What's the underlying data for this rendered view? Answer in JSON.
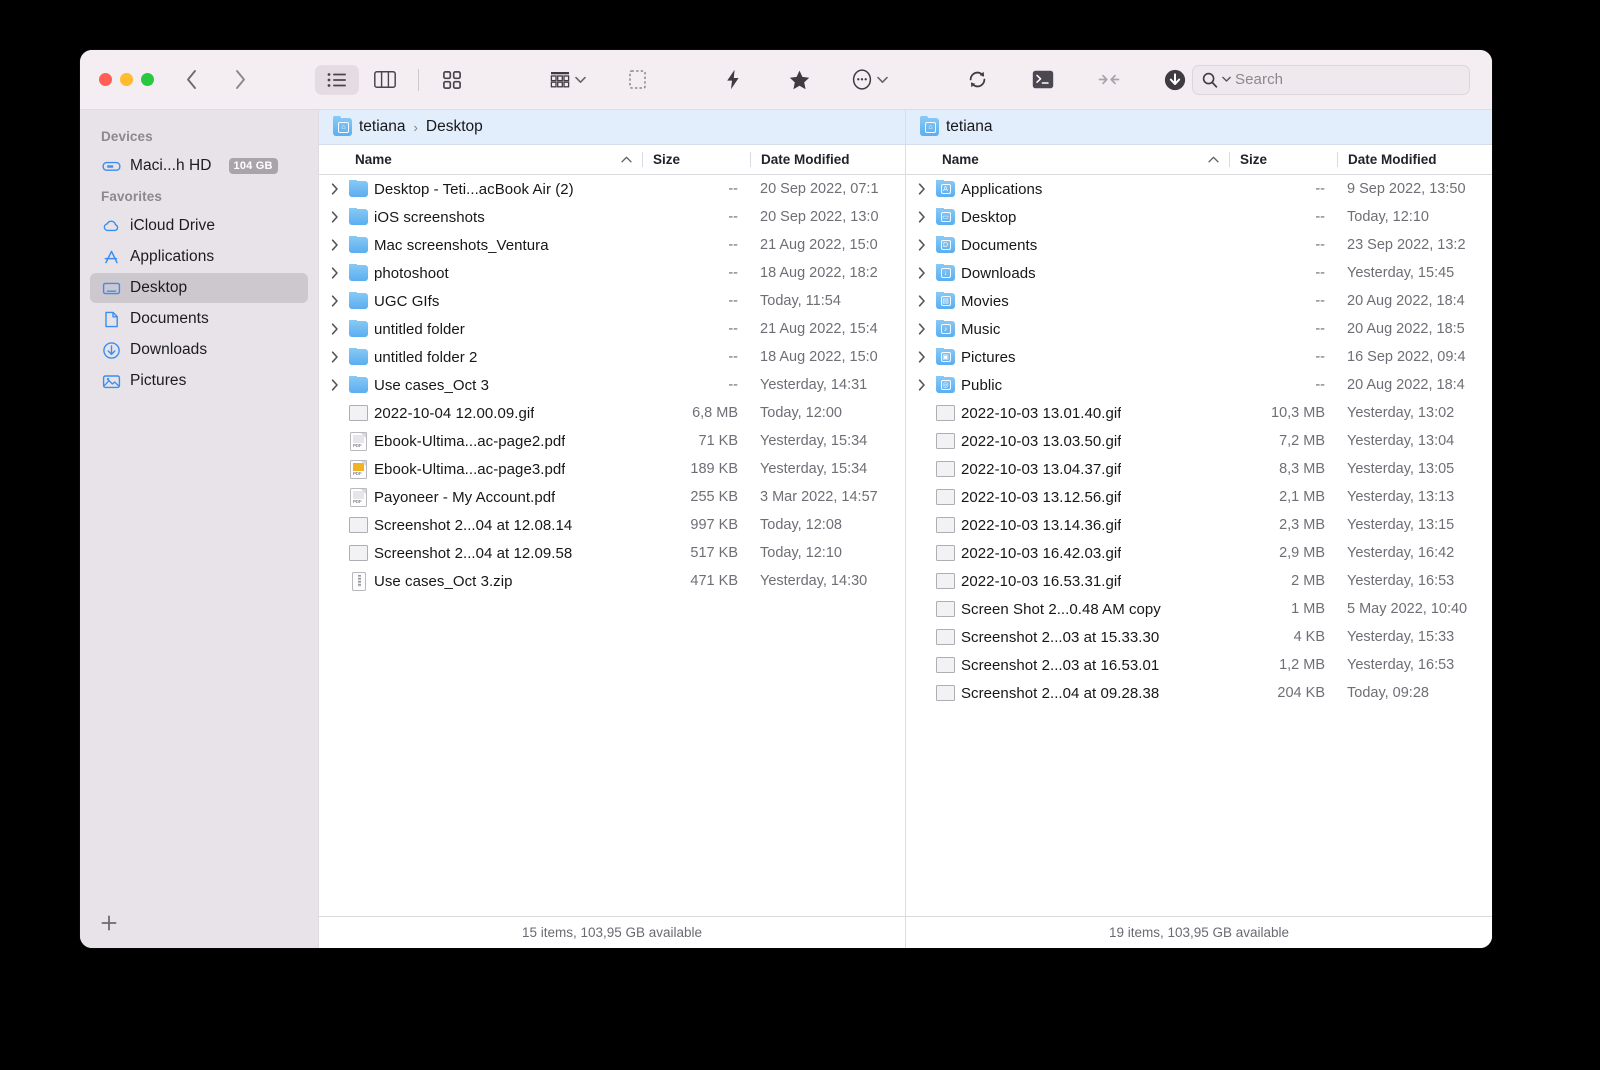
{
  "window": {
    "traffic_lights": [
      "close",
      "minimize",
      "zoom"
    ]
  },
  "toolbar": {
    "back_label": "Back",
    "forward_label": "Forward",
    "view_list_label": "List view",
    "view_column_label": "Column view",
    "view_gallery_label": "Gallery view",
    "group_label": "Group items",
    "selection_label": "Selection",
    "quickaction_label": "Quick actions",
    "favorite_label": "Favorite",
    "more_label": "More",
    "sync_label": "Sync",
    "terminal_label": "Terminal",
    "merge_label": "Merge",
    "download_label": "Download"
  },
  "search": {
    "placeholder": "Search",
    "value": ""
  },
  "sidebar": {
    "sections": [
      {
        "title": "Devices",
        "items": [
          {
            "label": "Maci...h HD",
            "icon": "harddisk-icon",
            "badge": "104 GB",
            "selected": false
          }
        ]
      },
      {
        "title": "Favorites",
        "items": [
          {
            "label": "iCloud Drive",
            "icon": "cloud-icon",
            "badge": "",
            "selected": false
          },
          {
            "label": "Applications",
            "icon": "appstore-icon",
            "badge": "",
            "selected": false
          },
          {
            "label": "Desktop",
            "icon": "desktop-icon",
            "badge": "",
            "selected": true
          },
          {
            "label": "Documents",
            "icon": "document-icon",
            "badge": "",
            "selected": false
          },
          {
            "label": "Downloads",
            "icon": "download-circle-icon",
            "badge": "",
            "selected": false
          },
          {
            "label": "Pictures",
            "icon": "photo-icon",
            "badge": "",
            "selected": false
          }
        ]
      }
    ],
    "add_button_label": "+"
  },
  "panes": [
    {
      "breadcrumb": [
        "tetiana",
        "Desktop"
      ],
      "columns": {
        "name": "Name",
        "size": "Size",
        "date": "Date Modified"
      },
      "sort": "name-ascending",
      "status": "15 items, 103,95 GB available",
      "rows": [
        {
          "name": "Desktop - Teti...acBook Air (2)",
          "size": "--",
          "date": "20 Sep 2022, 07:1",
          "kind": "folder",
          "glyph": "",
          "expandable": true
        },
        {
          "name": "iOS screenshots",
          "size": "--",
          "date": "20 Sep 2022, 13:0",
          "kind": "folder",
          "glyph": "",
          "expandable": true
        },
        {
          "name": "Mac screenshots_Ventura",
          "size": "--",
          "date": "21 Aug 2022, 15:0",
          "kind": "folder",
          "glyph": "",
          "expandable": true
        },
        {
          "name": "photoshoot",
          "size": "--",
          "date": "18 Aug 2022, 18:2",
          "kind": "folder",
          "glyph": "",
          "expandable": true
        },
        {
          "name": "UGC GIfs",
          "size": "--",
          "date": "Today, 11:54",
          "kind": "folder",
          "glyph": "",
          "expandable": true
        },
        {
          "name": "untitled folder",
          "size": "--",
          "date": "21 Aug 2022, 15:4",
          "kind": "folder",
          "glyph": "",
          "expandable": true
        },
        {
          "name": "untitled folder 2",
          "size": "--",
          "date": "18 Aug 2022, 15:0",
          "kind": "folder",
          "glyph": "",
          "expandable": true
        },
        {
          "name": "Use cases_Oct 3",
          "size": "--",
          "date": "Yesterday, 14:31",
          "kind": "folder",
          "glyph": "",
          "expandable": true
        },
        {
          "name": "2022-10-04 12.00.09.gif",
          "size": "6,8 MB",
          "date": "Today, 12:00",
          "kind": "image",
          "thumb": "magenta",
          "expandable": false
        },
        {
          "name": "Ebook-Ultima...ac-page2.pdf",
          "size": "71 KB",
          "date": "Yesterday, 15:34",
          "kind": "pdf",
          "thumb": "plain",
          "expandable": false
        },
        {
          "name": "Ebook-Ultima...ac-page3.pdf",
          "size": "189 KB",
          "date": "Yesterday, 15:34",
          "kind": "pdf",
          "thumb": "yellow",
          "expandable": false
        },
        {
          "name": "Payoneer - My Account.pdf",
          "size": "255 KB",
          "date": "3 Mar 2022, 14:57",
          "kind": "pdf",
          "thumb": "plain",
          "expandable": false
        },
        {
          "name": "Screenshot 2...04 at 12.08.14",
          "size": "997 KB",
          "date": "Today, 12:08",
          "kind": "image",
          "thumb": "grey",
          "expandable": false
        },
        {
          "name": "Screenshot 2...04 at 12.09.58",
          "size": "517 KB",
          "date": "Today, 12:10",
          "kind": "image",
          "thumb": "lightgrey",
          "expandable": false
        },
        {
          "name": "Use cases_Oct 3.zip",
          "size": "471 KB",
          "date": "Yesterday, 14:30",
          "kind": "zip",
          "thumb": "",
          "expandable": false
        }
      ]
    },
    {
      "breadcrumb": [
        "tetiana"
      ],
      "columns": {
        "name": "Name",
        "size": "Size",
        "date": "Date Modified"
      },
      "sort": "name-ascending",
      "status": "19 items, 103,95 GB available",
      "rows": [
        {
          "name": "Applications",
          "size": "--",
          "date": "9 Sep 2022, 13:50",
          "kind": "folder",
          "glyph": "A",
          "expandable": true
        },
        {
          "name": "Desktop",
          "size": "--",
          "date": "Today, 12:10",
          "kind": "folder",
          "glyph": "▭",
          "expandable": true
        },
        {
          "name": "Documents",
          "size": "--",
          "date": "23 Sep 2022, 13:2",
          "kind": "folder",
          "glyph": "D",
          "expandable": true
        },
        {
          "name": "Downloads",
          "size": "--",
          "date": "Yesterday, 15:45",
          "kind": "folder",
          "glyph": "↓",
          "expandable": true
        },
        {
          "name": "Movies",
          "size": "--",
          "date": "20 Aug 2022, 18:4",
          "kind": "folder",
          "glyph": "▤",
          "expandable": true
        },
        {
          "name": "Music",
          "size": "--",
          "date": "20 Aug 2022, 18:5",
          "kind": "folder",
          "glyph": "♪",
          "expandable": true
        },
        {
          "name": "Pictures",
          "size": "--",
          "date": "16 Sep 2022, 09:4",
          "kind": "folder",
          "glyph": "▣",
          "expandable": true
        },
        {
          "name": "Public",
          "size": "--",
          "date": "20 Aug 2022, 18:4",
          "kind": "folder",
          "glyph": "◎",
          "expandable": true
        },
        {
          "name": "2022-10-03 13.01.40.gif",
          "size": "10,3 MB",
          "date": "Yesterday, 13:02",
          "kind": "image",
          "thumb": "purple",
          "expandable": false
        },
        {
          "name": "2022-10-03 13.03.50.gif",
          "size": "7,2 MB",
          "date": "Yesterday, 13:04",
          "kind": "image",
          "thumb": "purple2",
          "expandable": false
        },
        {
          "name": "2022-10-03 13.04.37.gif",
          "size": "8,3 MB",
          "date": "Yesterday, 13:05",
          "kind": "image",
          "thumb": "magenta",
          "expandable": false
        },
        {
          "name": "2022-10-03 13.12.56.gif",
          "size": "2,1 MB",
          "date": "Yesterday, 13:13",
          "kind": "image",
          "thumb": "violet",
          "expandable": false
        },
        {
          "name": "2022-10-03 13.14.36.gif",
          "size": "2,3 MB",
          "date": "Yesterday, 13:15",
          "kind": "image",
          "thumb": "indigo",
          "expandable": false
        },
        {
          "name": "2022-10-03 16.42.03.gif",
          "size": "2,9 MB",
          "date": "Yesterday, 16:42",
          "kind": "image",
          "thumb": "white",
          "expandable": false
        },
        {
          "name": "2022-10-03 16.53.31.gif",
          "size": "2 MB",
          "date": "Yesterday, 16:53",
          "kind": "image",
          "thumb": "white2",
          "expandable": false
        },
        {
          "name": "Screen Shot 2...0.48 AM copy",
          "size": "1 MB",
          "date": "5 May 2022, 10:40",
          "kind": "image",
          "thumb": "purple3",
          "expandable": false
        },
        {
          "name": "Screenshot 2...03 at 15.33.30",
          "size": "4 KB",
          "date": "Yesterday, 15:33",
          "kind": "image",
          "thumb": "lightgrey",
          "expandable": false
        },
        {
          "name": "Screenshot 2...03 at 16.53.01",
          "size": "1,2 MB",
          "date": "Yesterday, 16:53",
          "kind": "image",
          "thumb": "white2",
          "expandable": false
        },
        {
          "name": "Screenshot 2...04 at 09.28.38",
          "size": "204 KB",
          "date": "Today, 09:28",
          "kind": "image",
          "thumb": "lightgrey",
          "expandable": false
        }
      ]
    }
  ],
  "colors": {
    "accent_blue": "#3b8ef0",
    "toolbar_bg": "#f4eef3",
    "sidebar_bg": "#e7e3e8",
    "crumb_bg": "#e3eefc",
    "selected_sidebar": "#cdc8ce"
  }
}
